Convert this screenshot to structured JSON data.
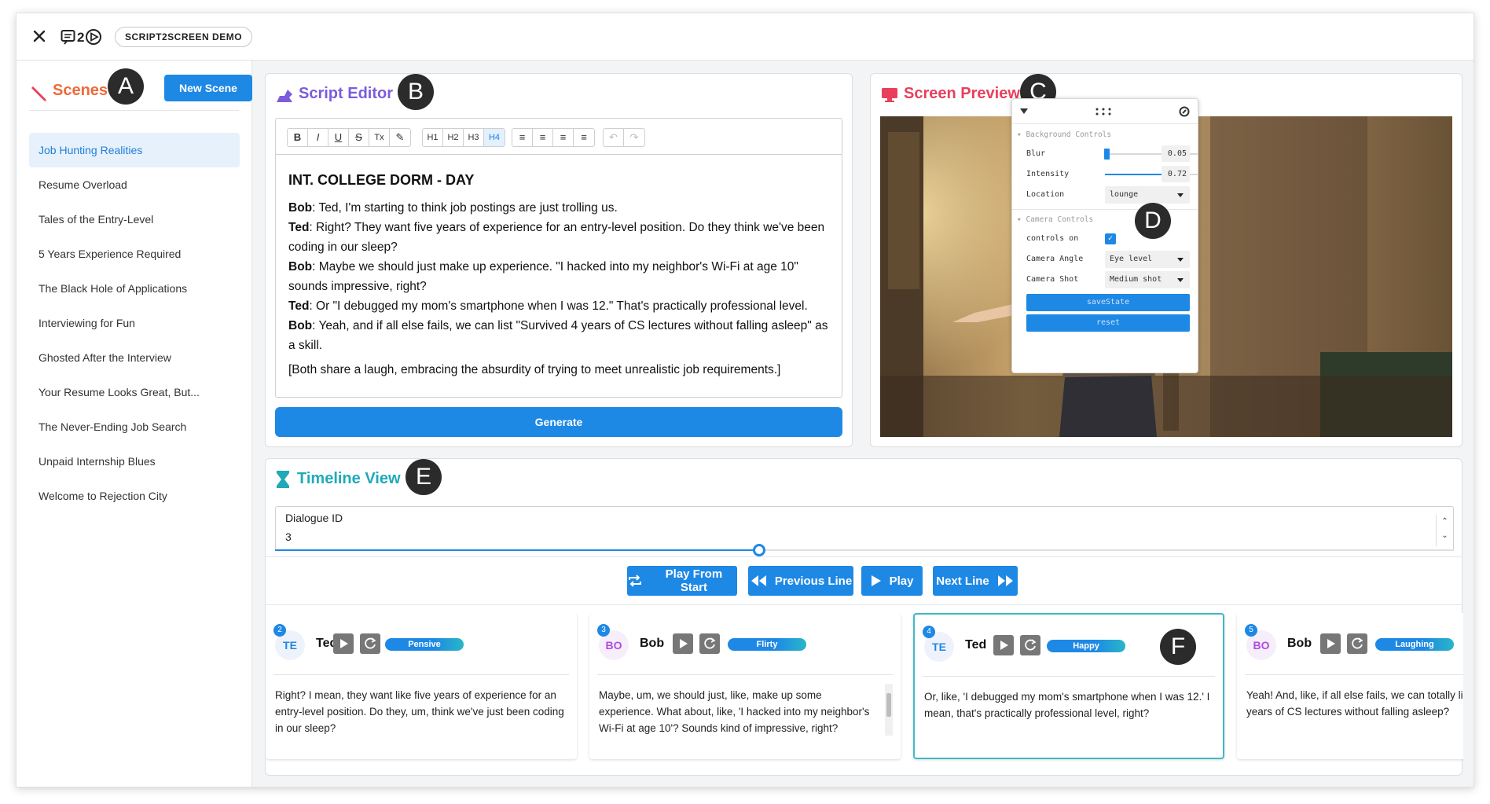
{
  "topbar": {
    "badge": "SCRIPT2SCREEN DEMO"
  },
  "sidebar": {
    "title": "Scenes",
    "marker": "A",
    "new_scene": "New Scene",
    "scenes": [
      "Job Hunting Realities",
      "Resume Overload",
      "Tales of the Entry-Level",
      "5 Years Experience Required",
      "The Black Hole of Applications",
      "Interviewing for Fun",
      "Ghosted After the Interview",
      "Your Resume Looks Great, But...",
      "The Never-Ending Job Search",
      "Unpaid Internship Blues",
      "Welcome to Rejection City"
    ]
  },
  "editor": {
    "title": "Script Editor",
    "marker": "B",
    "toolbar": {
      "format": [
        "B",
        "I",
        "U",
        "S",
        "Tx",
        "✎"
      ],
      "headings": [
        "H1",
        "H2",
        "H3",
        "H4"
      ],
      "align": [
        "≡",
        "≡",
        "≡",
        "≡"
      ],
      "history": [
        "↶",
        "↷"
      ]
    },
    "scene_heading": "INT. COLLEGE DORM - DAY",
    "lines": [
      {
        "speaker": "Bob",
        "text": ": Ted, I'm starting to think job postings are just trolling us."
      },
      {
        "speaker": "Ted",
        "text": ": Right? They want five years of experience for an entry-level position. Do they think we've been coding in our sleep?"
      },
      {
        "speaker": "Bob",
        "text": ": Maybe we should just make up experience. \"I hacked into my neighbor's Wi-Fi at age 10\" sounds impressive, right?"
      },
      {
        "speaker": "Ted",
        "text": ": Or \"I debugged my mom's smartphone when I was 12.\" That's practically professional level."
      },
      {
        "speaker": "Bob",
        "text": ": Yeah, and if all else fails, we can list \"Survived 4 years of CS lectures without falling asleep\" as a skill."
      }
    ],
    "stage_direction": "[Both share a laugh, embracing the absurdity of trying to meet unrealistic job requirements.]",
    "generate": "Generate"
  },
  "preview": {
    "title": "Screen Preview",
    "marker": "C",
    "gui_marker": "D",
    "gui": {
      "background_section": "Background Controls",
      "blur_label": "Blur",
      "blur_value": "0.05",
      "blur_level": 0.05,
      "intensity_label": "Intensity",
      "intensity_value": "0.72",
      "intensity_level": 0.72,
      "location_label": "Location",
      "location_value": "lounge",
      "camera_section": "Camera Controls",
      "controls_on_label": "controls on",
      "controls_on": true,
      "angle_label": "Camera Angle",
      "angle_value": "Eye level",
      "shot_label": "Camera Shot",
      "shot_value": "Medium shot",
      "save_button": "saveState",
      "reset_button": "reset"
    }
  },
  "timeline": {
    "title": "Timeline View",
    "marker": "E",
    "card_marker": "F",
    "dialogue_label": "Dialogue ID",
    "dialogue_value": "3",
    "progress": 0.41,
    "buttons": {
      "play_from_start": "Play From Start",
      "previous": "Previous Line",
      "play": "Play",
      "next": "Next Line"
    },
    "lines": [
      {
        "num": "2",
        "initials": "TE",
        "speaker": "Ted",
        "emotion": "Pensive",
        "text": "Right? I mean, they want like five years of experience for an entry-level position. Do they, um, think we've just been coding in our sleep?"
      },
      {
        "num": "3",
        "initials": "BO",
        "speaker": "Bob",
        "emotion": "Flirty",
        "text": "Maybe, um, we should just, like, make up some experience. What about, like, 'I hacked into my neighbor's Wi-Fi at age 10'? Sounds kind of impressive, right?"
      },
      {
        "num": "4",
        "initials": "TE",
        "speaker": "Ted",
        "emotion": "Happy",
        "text": "Or, like, 'I debugged my mom's smartphone when I was 12.' I mean, that's practically professional level, right?"
      },
      {
        "num": "5",
        "initials": "BO",
        "speaker": "Bob",
        "emotion": "Laughing",
        "text": "Yeah! And, like, if all else fails, we can totally list, like, four years of CS lectures without falling asleep?"
      }
    ]
  },
  "colors": {
    "accent": "#1e88e5",
    "scenes_title": "#f0693a",
    "editor_title": "#7c5cdb",
    "preview_title": "#e8405c",
    "timeline_title": "#1faab8"
  }
}
